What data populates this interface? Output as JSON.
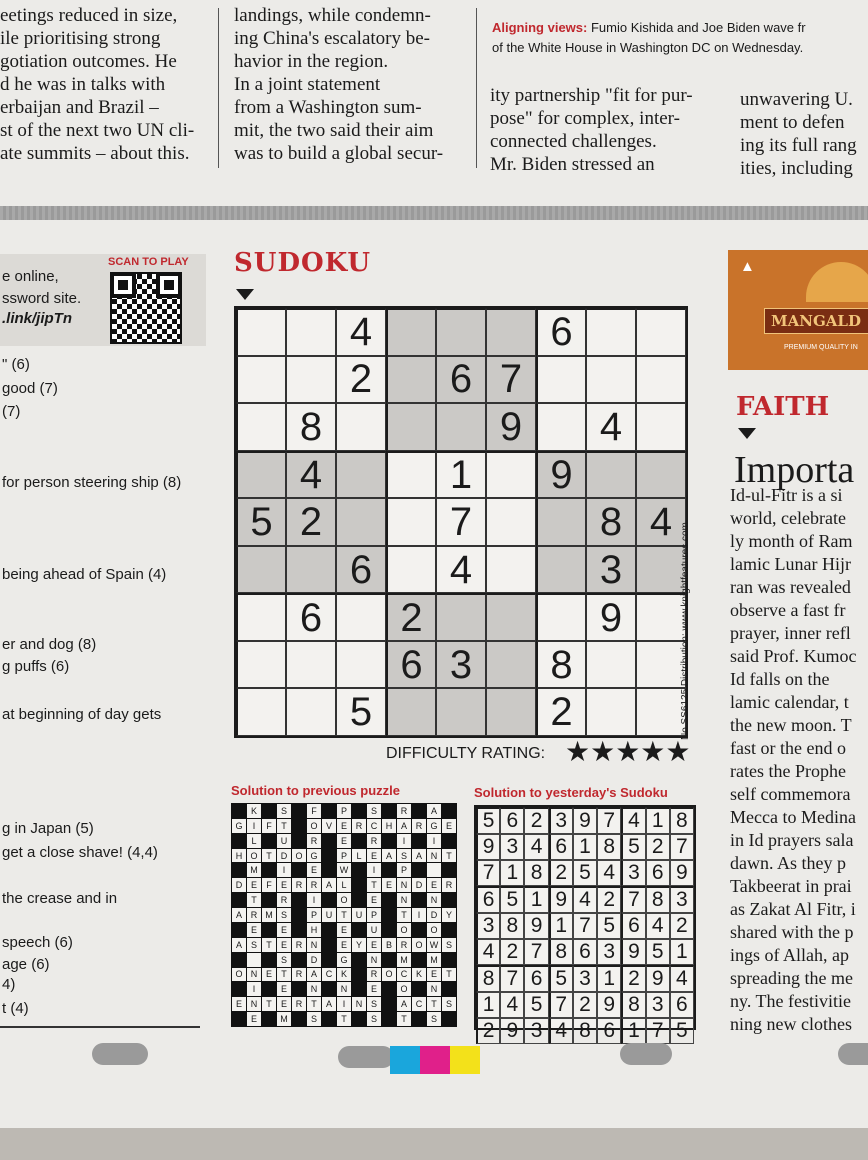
{
  "top_columns": {
    "col1": [
      "eetings reduced in size,",
      "ile prioritising strong",
      "gotiation outcomes. He",
      "d he was in talks with",
      "erbaijan and Brazil –",
      "st of the next two UN cli-",
      "ate summits – about this."
    ],
    "col2": [
      "landings, while condemn-",
      "ing China's escalatory be-",
      "havior in the region.",
      "In a joint statement",
      "from a Washington sum-",
      "mit, the two said their aim",
      "was to build a global secur-"
    ],
    "col3": [
      "ity partnership \"fit for pur-",
      "pose\" for complex, inter-",
      "connected challenges.",
      "Mr. Biden stressed an"
    ],
    "col4": [
      "unwavering U.",
      "ment to defen",
      "ing its full rang",
      "ities, including"
    ]
  },
  "caption": {
    "label": "Aligning views:",
    "line1": "Fumio Kishida and Joe Biden wave fr",
    "line2": "of the White House in Washington DC on Wednesday."
  },
  "crossword_panel": {
    "scan_label": "SCAN TO PLAY",
    "lines": [
      "e online,",
      "ssword site.",
      ".link/jipTn"
    ],
    "clues": [
      "\" (6)",
      "good (7)",
      "(7)",
      "for person steering ship (8)",
      "being ahead of Spain (4)",
      "er and dog (8)",
      "g puffs (6)",
      "at beginning of day gets",
      "g in Japan (5)",
      "get a close shave! (4,4)",
      "the crease and in",
      "speech (6)",
      "age (6)",
      "4)",
      "t (4)"
    ]
  },
  "sudoku": {
    "title": "SUDOKU",
    "grid": [
      [
        "",
        "",
        "4",
        "",
        "",
        "",
        "6",
        "",
        ""
      ],
      [
        "",
        "",
        "2",
        "",
        "6",
        "7",
        "",
        "",
        ""
      ],
      [
        "",
        "8",
        "",
        "",
        "",
        "9",
        "",
        "4",
        ""
      ],
      [
        "",
        "4",
        "",
        "",
        "1",
        "",
        "9",
        "",
        ""
      ],
      [
        "5",
        "2",
        "",
        "",
        "7",
        "",
        "",
        "8",
        "4"
      ],
      [
        "",
        "",
        "6",
        "",
        "4",
        "",
        "",
        "3",
        ""
      ],
      [
        "",
        "6",
        "",
        "2",
        "",
        "",
        "",
        "9",
        ""
      ],
      [
        "",
        "",
        "",
        "6",
        "3",
        "",
        "8",
        "",
        ""
      ],
      [
        "",
        "",
        "5",
        "",
        "",
        "",
        "2",
        "",
        ""
      ]
    ],
    "difficulty_label": "DIFFICULTY RATING:",
    "difficulty_stars": 5,
    "stars_text": "★★★★★",
    "credit": "No SS6125 Distribution: www.knightfeatures.com"
  },
  "previous_solution": {
    "title": "Solution to previous puzzle",
    "rows": [
      "#K#S#F#P#S#R#A#",
      "GIFT#OVERCHARGE",
      "#L#U#R#E#R#I#I#",
      "HOTDOG#PLEASANT",
      "#M#I#E#W#I#P#.#",
      "DEFERRAL#TENDER",
      "#T#R#I#O#E#N#N#",
      "ARMS#PUTUP#TIDY",
      "#E#E#H#E#U#O#O#",
      "ASTERN#EYEBROWS",
      "#.#S#D#G#N#M#M#",
      "ONETRACK#ROCKET",
      "#I#E#N#N#E#O#N#",
      "ENTERTAINS#ACTS",
      "#E#M#S#T#S#T#S#"
    ]
  },
  "yesterday_solution": {
    "title": "Solution to yesterday's Sudoku",
    "rows": [
      "562397418",
      "934618527",
      "718254369",
      "651942783",
      "389175642",
      "427863951",
      "876531294",
      "145729836",
      "293486175"
    ]
  },
  "right_column": {
    "ad_name": "MANGALD",
    "ad_tag": "PREMIUM QUALITY IN",
    "section": "FAITH",
    "headline": "Importa",
    "body": [
      "Id-ul-Fitr is a si",
      "world, celebrate",
      "ly month of Ram",
      "lamic Lunar Hijr",
      "ran was revealed",
      "observe a fast fr",
      "prayer, inner refl",
      "said Prof. Kumoc",
      "Id falls on the",
      "lamic calendar, t",
      "the new moon. T",
      "fast or the end o",
      "rates the Prophe",
      "self commemora",
      "Mecca to Medina",
      "in Id prayers sala",
      "dawn. As they p",
      "Takbeerat in prai",
      "as Zakat Al Fitr, i",
      "shared with the p",
      "ings of Allah, ap",
      "spreading the me",
      "ny. The festivitie",
      "ning new clothes"
    ]
  },
  "colors": {
    "accent_red": "#c0282e",
    "shade": "#cbc9c6",
    "cyan": "#1aa6dc",
    "magenta": "#e0208a",
    "yellow": "#f3e11a"
  }
}
